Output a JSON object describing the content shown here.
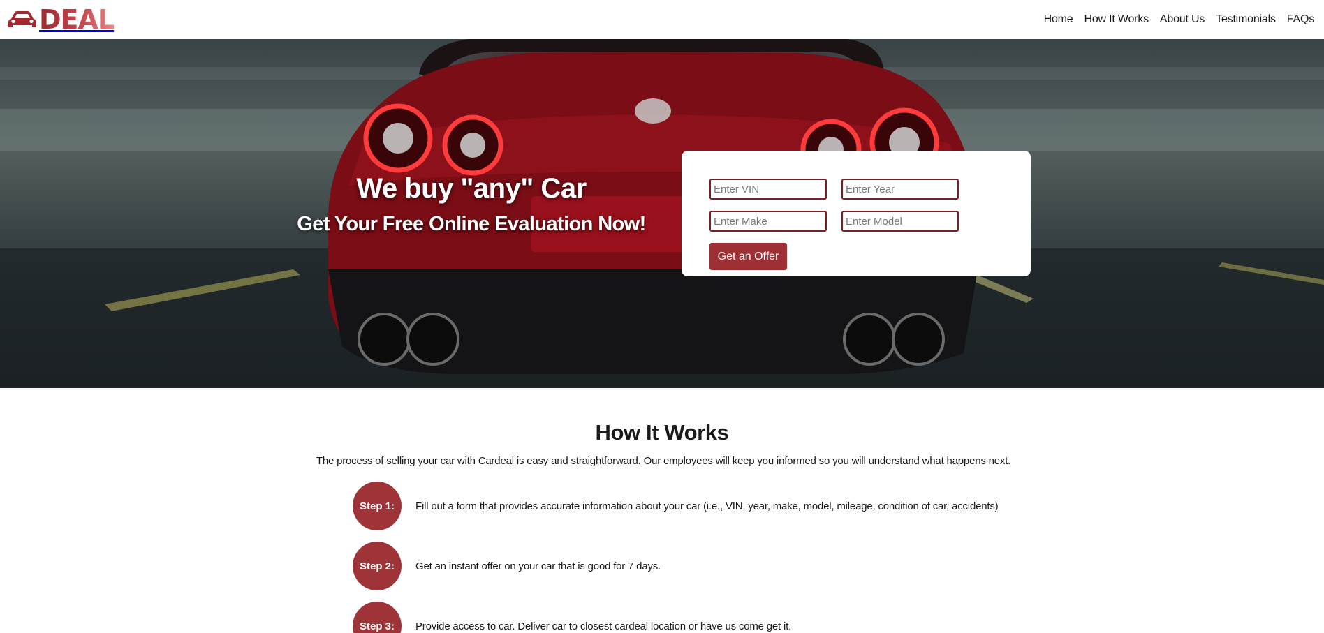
{
  "brand": {
    "logo_text": "DEAL",
    "logo_icon": "car-icon",
    "accent": "#9e2f34"
  },
  "nav": {
    "items": [
      {
        "label": "Home"
      },
      {
        "label": "How It Works"
      },
      {
        "label": "About Us"
      },
      {
        "label": "Testimonials"
      },
      {
        "label": "FAQs"
      }
    ]
  },
  "hero": {
    "heading": "We buy \"any\" Car",
    "subheading": "Get Your Free Online Evaluation Now!",
    "form": {
      "vin_placeholder": "Enter VIN",
      "year_placeholder": "Enter Year",
      "make_placeholder": "Enter Make",
      "model_placeholder": "Enter Model",
      "submit_label": "Get an Offer"
    }
  },
  "how_it_works": {
    "title": "How It Works",
    "description": "The process of selling your car with Cardeal is easy and straightforward. Our employees will keep you informed so you will understand what happens next.",
    "steps": [
      {
        "label": "Step 1:",
        "text": "Fill out a form that provides accurate information about your car (i.e., VIN, year, make, model, mileage, condition of car, accidents)"
      },
      {
        "label": "Step 2:",
        "text": "Get an instant offer on your car that is good for 7 days."
      },
      {
        "label": "Step 3:",
        "text": "Provide access to car. Deliver car to closest cardeal location or have us come get it."
      }
    ]
  }
}
